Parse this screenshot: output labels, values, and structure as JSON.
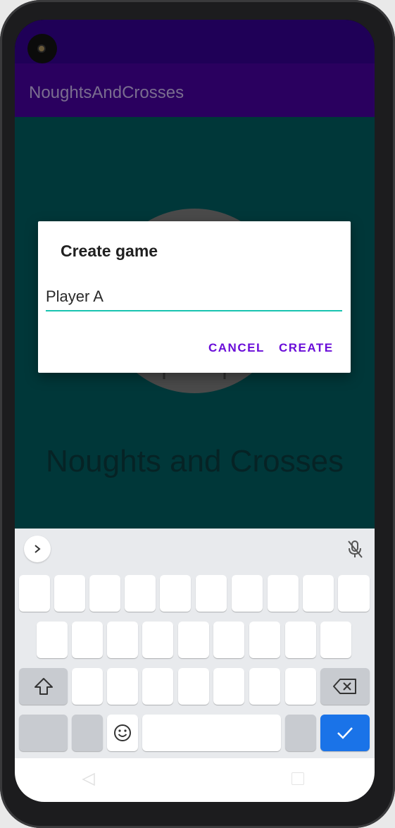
{
  "app": {
    "title": "NoughtsAndCrosses"
  },
  "content": {
    "main_title": "Noughts and Crosses"
  },
  "dialog": {
    "title": "Create game",
    "input_value": "Player A",
    "cancel_label": "CANCEL",
    "create_label": "CREATE"
  },
  "keyboard": {
    "icons": [
      "chevron-right-icon",
      "mic-off-icon",
      "shift-icon",
      "backspace-icon",
      "emoji-icon",
      "checkmark-icon"
    ]
  },
  "colors": {
    "status_bar": "#1f0057",
    "app_bar": "#2a005f",
    "background": "#003739",
    "accent": "#6a0dd8",
    "input_underline": "#18c3b0",
    "enter_key": "#1a73e8"
  }
}
